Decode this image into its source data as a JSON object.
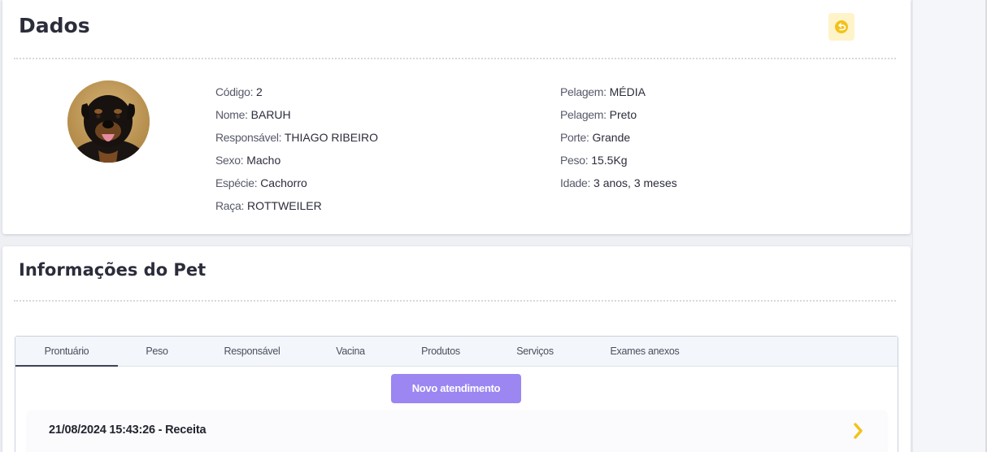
{
  "dados": {
    "title": "Dados",
    "back_icon": "undo-arrow-icon",
    "colors": {
      "back_bg": "#fff3c9",
      "back_icon": "#f2c21a"
    }
  },
  "pet": {
    "photo_alt": "Foto do pet",
    "fields_left": [
      {
        "label": "Código:",
        "value": "2"
      },
      {
        "label": "Nome:",
        "value": "BARUH"
      },
      {
        "label": "Responsável:",
        "value": "THIAGO RIBEIRO"
      },
      {
        "label": "Sexo:",
        "value": "Macho"
      },
      {
        "label": "Espécie:",
        "value": "Cachorro"
      },
      {
        "label": "Raça:",
        "value": "ROTTWEILER"
      }
    ],
    "fields_right": [
      {
        "label": "Pelagem:",
        "value": "MÉDIA"
      },
      {
        "label": "Pelagem:",
        "value": "Preto"
      },
      {
        "label": "Porte:",
        "value": "Grande"
      },
      {
        "label": "Peso:",
        "value": "15.5Kg"
      },
      {
        "label": "Idade:",
        "value": "3 anos, 3 meses"
      }
    ]
  },
  "info": {
    "title": "Informações do Pet",
    "tabs": [
      {
        "label": "Prontuário",
        "active": true
      },
      {
        "label": "Peso"
      },
      {
        "label": "Responsável"
      },
      {
        "label": "Vacina"
      },
      {
        "label": "Produtos"
      },
      {
        "label": "Serviços"
      },
      {
        "label": "Exames anexos"
      }
    ],
    "new_button": "Novo atendimento",
    "records": [
      {
        "text": "21/08/2024 15:43:26 - Receita",
        "icon": "chevron-right-icon"
      }
    ],
    "colors": {
      "button": "#9b86f2",
      "chevron": "#f2c21a"
    }
  }
}
